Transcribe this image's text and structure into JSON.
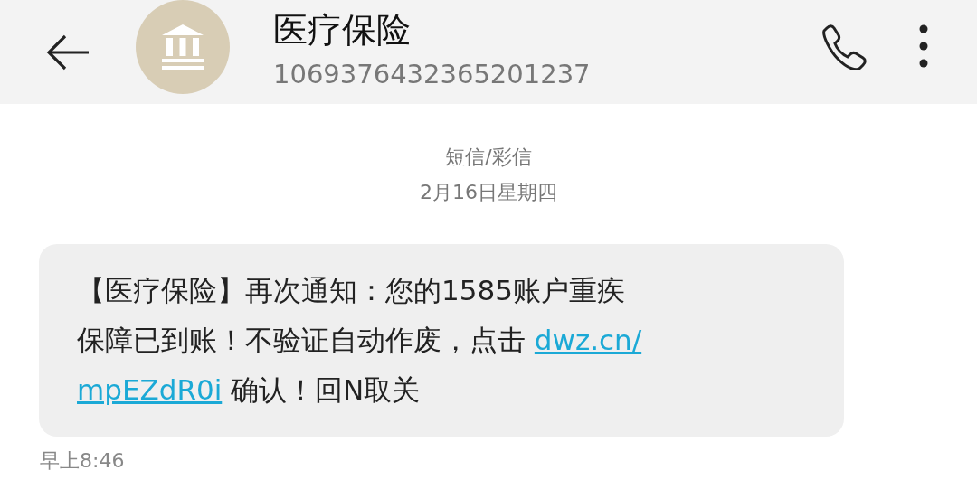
{
  "header": {
    "title": "医疗保险",
    "number": "1069376432365201237"
  },
  "thread": {
    "channel": "短信/彩信",
    "date": "2月16日星期四"
  },
  "message": {
    "lines": [
      [
        {
          "kind": "text",
          "text": "【医疗保险】再次通知：您的1585账户重疾"
        }
      ],
      [
        {
          "kind": "text",
          "text": "保障已到账！不验证自动作废，点击 "
        },
        {
          "kind": "link",
          "text": "dwz.cn/"
        }
      ],
      [
        {
          "kind": "link",
          "text": "mpEZdR0i"
        },
        {
          "kind": "text",
          "text": " 确认！回N取关"
        }
      ]
    ],
    "time": "早上8:46"
  }
}
